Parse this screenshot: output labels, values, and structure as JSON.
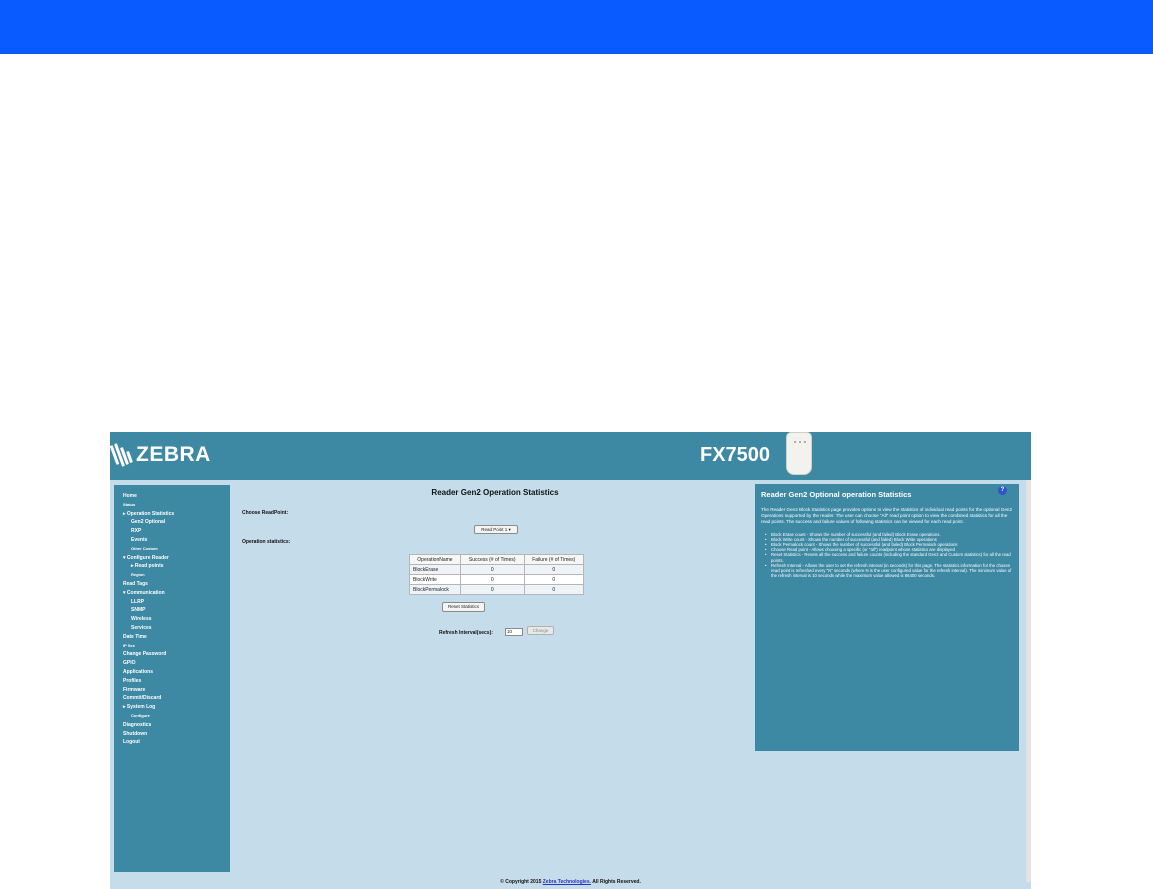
{
  "header": {
    "brand": "ZEBRA",
    "model": "FX7500"
  },
  "sidebar": {
    "items": [
      {
        "label": "Home"
      },
      {
        "label": "Status"
      },
      {
        "label": "▸ Operation Statistics"
      },
      {
        "label": "Gen2 Optional"
      },
      {
        "label": "RXP"
      },
      {
        "label": "Events"
      },
      {
        "label": "Other Custom"
      },
      {
        "label": "▾ Configure Reader"
      },
      {
        "label": "▸ Read points"
      },
      {
        "label": "Region"
      },
      {
        "label": "Read Tags"
      },
      {
        "label": "▾ Communication"
      },
      {
        "label": "LLRP"
      },
      {
        "label": "SNMP"
      },
      {
        "label": "Wireless"
      },
      {
        "label": "Services"
      },
      {
        "label": "Date Time"
      },
      {
        "label": "IP Sec"
      },
      {
        "label": "Change Password"
      },
      {
        "label": "GPIO"
      },
      {
        "label": "Applications"
      },
      {
        "label": "Profiles"
      },
      {
        "label": "Firmware"
      },
      {
        "label": "Commit/Discard"
      },
      {
        "label": "▸ System Log"
      },
      {
        "label": "Configure"
      },
      {
        "label": "Diagnostics"
      },
      {
        "label": "Shutdown"
      },
      {
        "label": "Logout"
      }
    ]
  },
  "main": {
    "title": "Reader Gen2 Operation Statistics",
    "choose_label": "Choose ReadPoint:",
    "readpoint_selected": "Read Point 1 ▾",
    "stats_label": "Operation statistics:",
    "table": {
      "headers": [
        "OperationName",
        "Success (# of Times)",
        "Failure (# of Times)"
      ],
      "rows": [
        [
          "BlockErase",
          "0",
          "0"
        ],
        [
          "BlockWrite",
          "0",
          "0"
        ],
        [
          "BlockPermalock",
          "0",
          "0"
        ]
      ]
    },
    "reset_label": "Reset Statistics",
    "refresh_label": "Refresh Interval(secs):",
    "refresh_value": "10",
    "change_label": "Change"
  },
  "help": {
    "title": "Reader Gen2 Optional operation Statistics",
    "intro": "The Reader Gen2 Block Statistics page provides options to view the statistics of individual read points for the optional Gen2 Operations supported by the reader. The user can choose \"All\" read point option to view the combined statistics for all the read points. The success and failure values of following statistics can be viewed for each read point.",
    "bullets": [
      "Block Erase count - Shows the number of successful (and failed) Block Erase operations.",
      "Block Write count - Shows the number of successful (and failed) Block Write operations",
      "Block Permalock count - Shows the number of successful (and failed) Block Permalock operations",
      "Choose Read point - Allows choosing a specific (or \"all\") readpoint whose statistics are displayed",
      "Reset Statistics - Resets all the success and failure counts (including the standard Gen2 and Custom statistics) for all the read points.",
      "Refresh Interval - Allows the user to set the refresh interval (in seconds) for this page. The statistics information for the chosen read point is refreshed every \"N\" seconds (where N is the user configured value for the refresh interval). The minimum value of the refresh interval is 10 seconds while the maximum value allowed is 86400 seconds."
    ]
  },
  "footer": {
    "prefix": "© Copyright 2015 ",
    "link": "Zebra Technologies.",
    "suffix": " All Rights Reserved."
  }
}
